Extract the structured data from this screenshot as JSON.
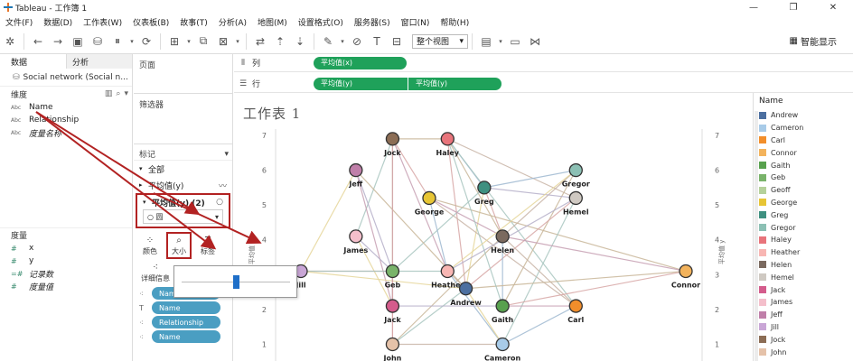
{
  "window": {
    "title": "Tableau - 工作簿 1",
    "min": "—",
    "max": "❐",
    "close": "✕"
  },
  "menu": [
    "文件(F)",
    "数据(D)",
    "工作表(W)",
    "仪表板(B)",
    "故事(T)",
    "分析(A)",
    "地图(M)",
    "设置格式(O)",
    "服务器(S)",
    "窗口(N)",
    "帮助(H)"
  ],
  "toolbar": {
    "view_select": "整个视图",
    "show_me": "智能显示"
  },
  "left_panel": {
    "tab_data": "数据",
    "tab_analysis": "分析",
    "datasource": "Social network (Social n...",
    "dimensions_label": "维度",
    "dimensions": [
      {
        "type": "Abc",
        "name": "Name",
        "italic": false
      },
      {
        "type": "Abc",
        "name": "Relationship",
        "italic": false
      },
      {
        "type": "Abc",
        "name": "度量名称",
        "italic": true
      }
    ],
    "measures_label": "度量",
    "measures": [
      {
        "type": "#",
        "name": "x",
        "italic": false
      },
      {
        "type": "#",
        "name": "y",
        "italic": false
      },
      {
        "type": "=#",
        "name": "记录数",
        "italic": true
      },
      {
        "type": "#",
        "name": "度量值",
        "italic": true
      }
    ]
  },
  "cards": {
    "pages": "页面",
    "filters": "筛选器",
    "marks": "标记",
    "all": "全部",
    "avg_y_line": "平均值(y)",
    "avg_y_circle": "平均值(y) (2)",
    "mark_type": "圆",
    "buttons": {
      "color": "颜色",
      "size": "大小",
      "label": "标签",
      "detail": "详细信息"
    },
    "pills": [
      "Name",
      "Name",
      "Relationship",
      "Name"
    ]
  },
  "shelves": {
    "columns_label": "列",
    "rows_label": "行",
    "col_pill": "平均值(x)",
    "row_pill_1": "平均值(y)",
    "row_pill_2": "平均值(y)"
  },
  "viz": {
    "title": "工作表 1",
    "y_axis_label": "平均值 y",
    "y_ticks": [
      "7",
      "6",
      "5",
      "4",
      "3",
      "2",
      "1"
    ],
    "nodes": [
      {
        "name": "Jock",
        "x": 3.0,
        "y": 6.9,
        "color": "#8c6d55"
      },
      {
        "name": "Haley",
        "x": 4.5,
        "y": 6.9,
        "color": "#e8747b"
      },
      {
        "name": "Jeff",
        "x": 2.0,
        "y": 6.0,
        "color": "#c07fa9"
      },
      {
        "name": "Gregor",
        "x": 8.0,
        "y": 6.0,
        "color": "#8cc0b4"
      },
      {
        "name": "Greg",
        "x": 5.5,
        "y": 5.5,
        "color": "#3e9080"
      },
      {
        "name": "George",
        "x": 4.0,
        "y": 5.2,
        "color": "#e7c535"
      },
      {
        "name": "Hemel",
        "x": 8.0,
        "y": 5.2,
        "color": "#cfc9c2"
      },
      {
        "name": "James",
        "x": 2.0,
        "y": 4.1,
        "color": "#f4bfcb"
      },
      {
        "name": "Helen",
        "x": 6.0,
        "y": 4.1,
        "color": "#7b6a5f"
      },
      {
        "name": "Jill",
        "x": 0.5,
        "y": 3.1,
        "color": "#c9a6d6"
      },
      {
        "name": "Geb",
        "x": 3.0,
        "y": 3.1,
        "color": "#79b36a"
      },
      {
        "name": "Heather",
        "x": 4.5,
        "y": 3.1,
        "color": "#f8b6b3"
      },
      {
        "name": "Connor",
        "x": 11.0,
        "y": 3.1,
        "color": "#f3b35c"
      },
      {
        "name": "Andrew",
        "x": 5.0,
        "y": 2.6,
        "color": "#4c6fa0"
      },
      {
        "name": "Jack",
        "x": 3.0,
        "y": 2.1,
        "color": "#d45c8c"
      },
      {
        "name": "Gaith",
        "x": 6.0,
        "y": 2.1,
        "color": "#58a14e"
      },
      {
        "name": "Carl",
        "x": 8.0,
        "y": 2.1,
        "color": "#f28e2b"
      },
      {
        "name": "John",
        "x": 3.0,
        "y": 1.0,
        "color": "#e5c2a9"
      },
      {
        "name": "Cameron",
        "x": 6.0,
        "y": 1.0,
        "color": "#a8cbe8"
      }
    ]
  },
  "legend": {
    "title": "Name",
    "items": [
      {
        "name": "Andrew",
        "color": "#4c6fa0"
      },
      {
        "name": "Cameron",
        "color": "#a8cbe8"
      },
      {
        "name": "Carl",
        "color": "#f28e2b"
      },
      {
        "name": "Connor",
        "color": "#f3b35c"
      },
      {
        "name": "Gaith",
        "color": "#58a14e"
      },
      {
        "name": "Geb",
        "color": "#79b36a"
      },
      {
        "name": "Geoff",
        "color": "#b5d19a"
      },
      {
        "name": "George",
        "color": "#e7c535"
      },
      {
        "name": "Greg",
        "color": "#3e9080"
      },
      {
        "name": "Gregor",
        "color": "#8cc0b4"
      },
      {
        "name": "Haley",
        "color": "#e8747b"
      },
      {
        "name": "Heather",
        "color": "#f8b6b3"
      },
      {
        "name": "Helen",
        "color": "#7b6a5f"
      },
      {
        "name": "Hemel",
        "color": "#cfc9c2"
      },
      {
        "name": "Jack",
        "color": "#d45c8c"
      },
      {
        "name": "James",
        "color": "#f4bfcb"
      },
      {
        "name": "Jeff",
        "color": "#c07fa9"
      },
      {
        "name": "Jill",
        "color": "#c9a6d6"
      },
      {
        "name": "Jock",
        "color": "#8c6d55"
      },
      {
        "name": "John",
        "color": "#e5c2a9"
      }
    ]
  },
  "size_slider": {
    "value": 0.5
  }
}
